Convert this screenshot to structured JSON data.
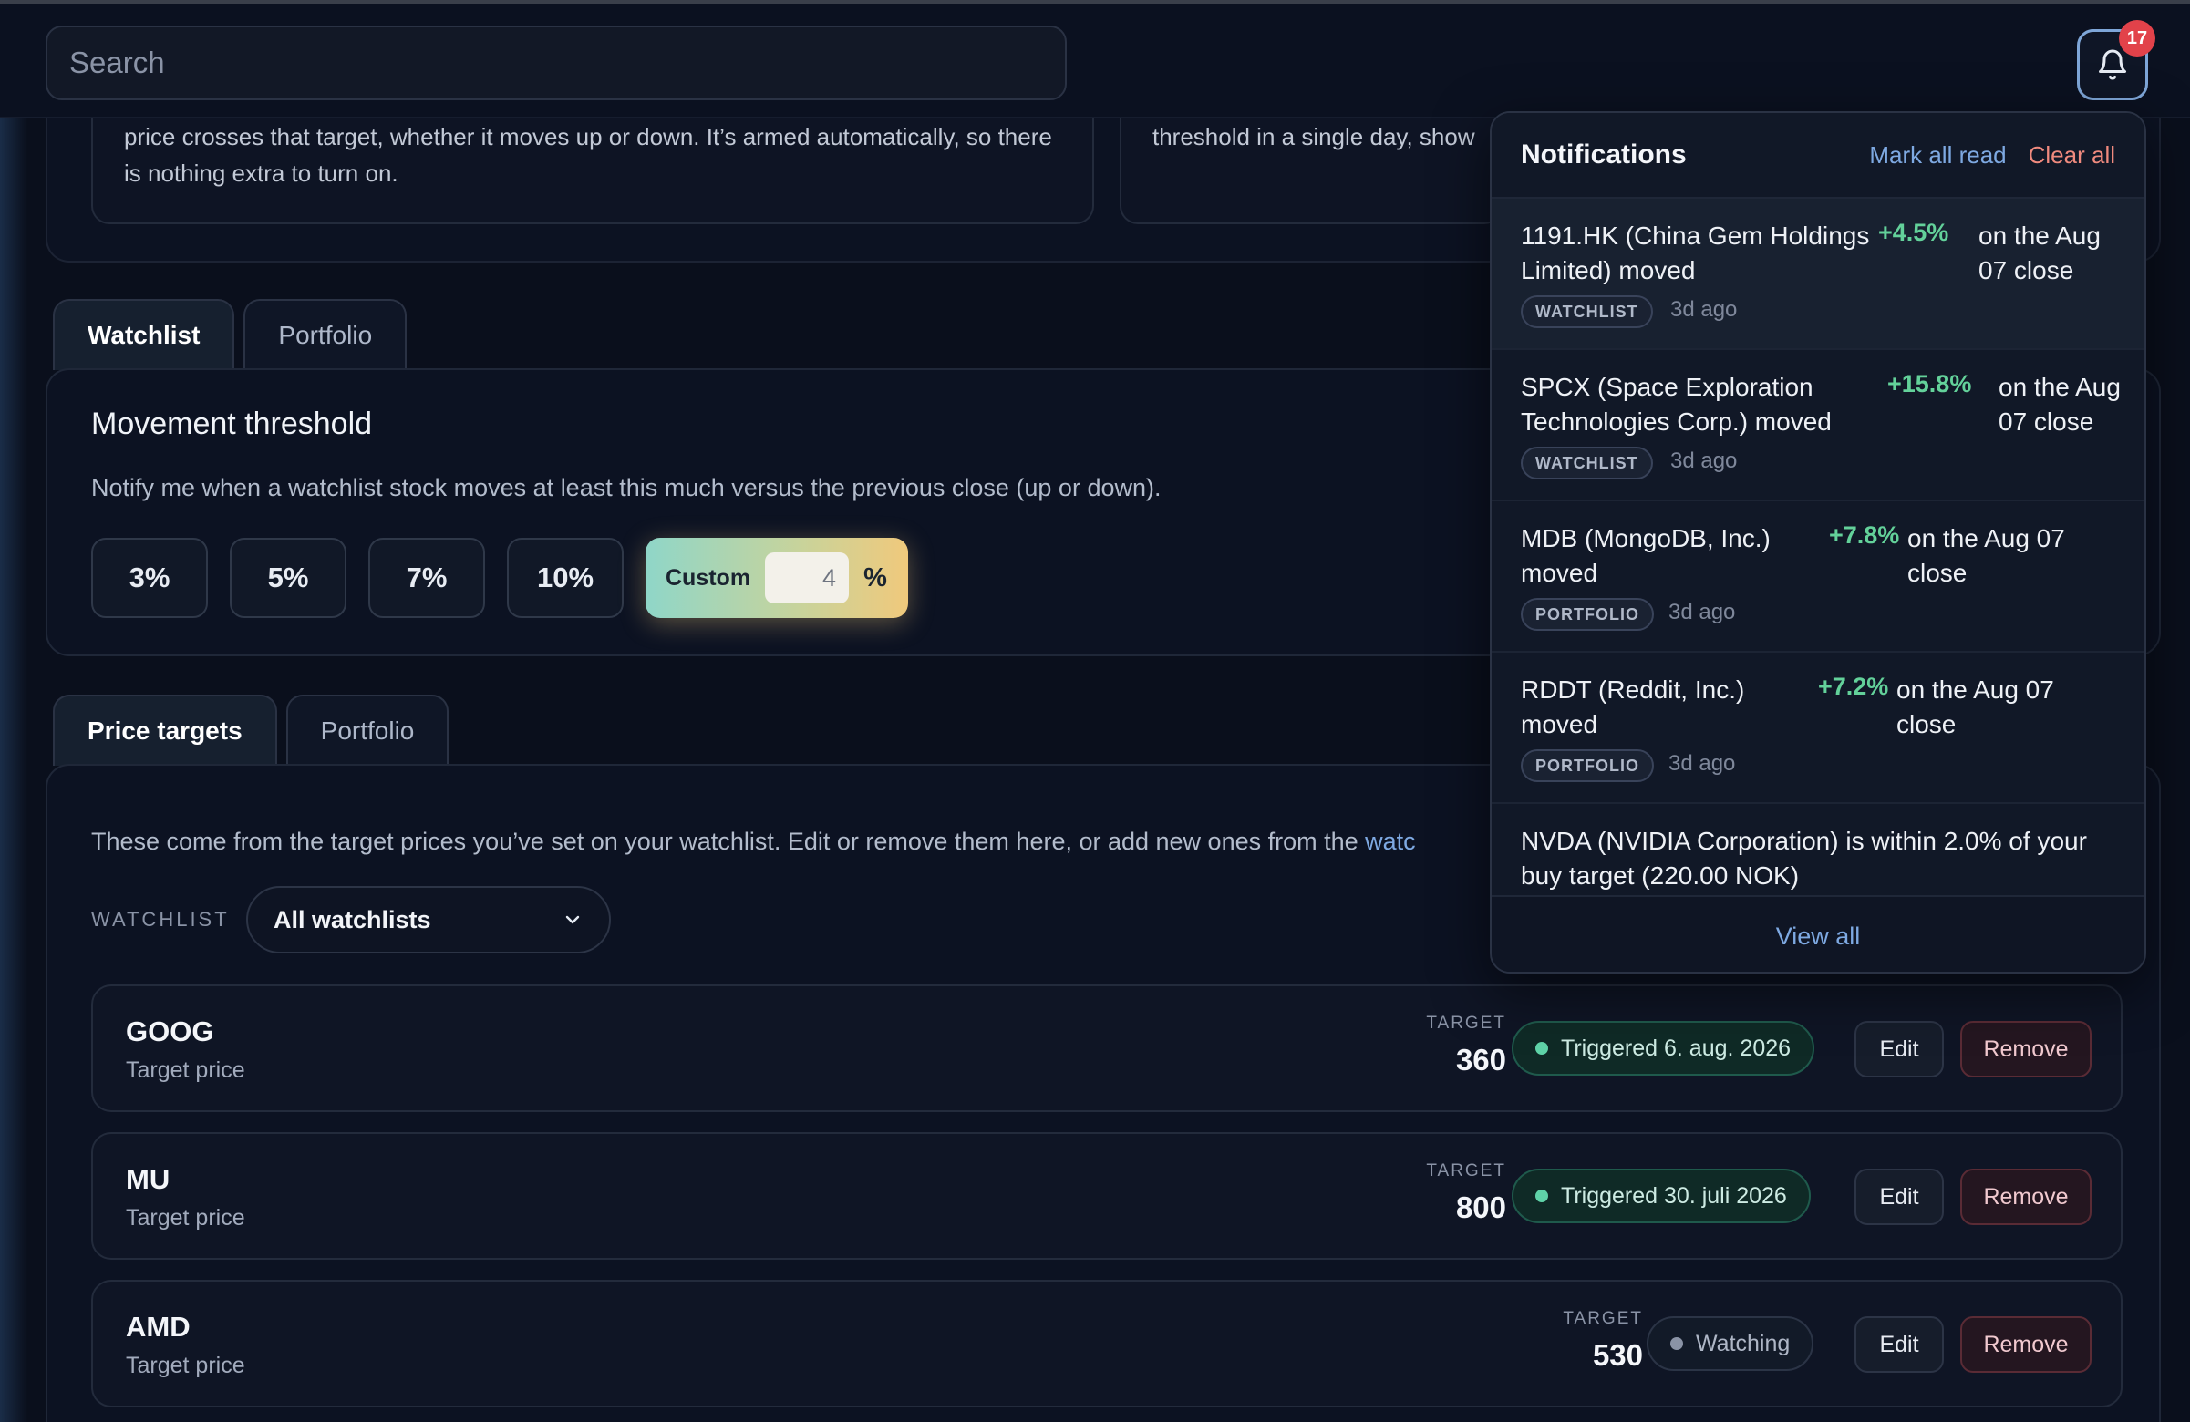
{
  "search": {
    "placeholder": "Search"
  },
  "notifications_badge": "17",
  "intro": {
    "card1_text": "price crosses that target, whether it moves up or down. It’s armed automatically, so there is nothing extra to turn on.",
    "card2_text": "threshold in a single day, show"
  },
  "threshold_tabs": [
    {
      "label": "Watchlist"
    },
    {
      "label": "Portfolio"
    }
  ],
  "movement": {
    "title": "Movement threshold",
    "description": "Notify me when a watchlist stock moves at least this much versus the previous close (up or down).",
    "presets": [
      "3%",
      "5%",
      "7%",
      "10%"
    ],
    "custom_label": "Custom",
    "custom_value": "4",
    "custom_unit": "%"
  },
  "target_tabs": [
    {
      "label": "Price targets"
    },
    {
      "label": "Portfolio"
    }
  ],
  "targets": {
    "description": "These come from the target prices you’ve set on your watchlist. Edit or remove them here, or add new ones from the ",
    "description_link": "watc",
    "filter_label": "WATCHLIST",
    "filter_value": "All watchlists",
    "target_label": "TARGET",
    "edit_label": "Edit",
    "remove_label": "Remove",
    "rows": [
      {
        "symbol": "GOOG",
        "subtitle": "Target price",
        "target": "360",
        "status": "Triggered 6. aug. 2026"
      },
      {
        "symbol": "MU",
        "subtitle": "Target price",
        "target": "800",
        "status": "Triggered 30. juli 2026"
      },
      {
        "symbol": "AMD",
        "subtitle": "Target price",
        "target": "530",
        "status": "Watching"
      }
    ]
  },
  "notifications": {
    "title": "Notifications",
    "mark_all_read": "Mark all read",
    "clear_all": "Clear all",
    "view_all": "View all",
    "items": [
      {
        "line1": "1191.HK (China Gem Holdings",
        "line2": "Limited) moved",
        "pct": "+4.5%",
        "rest1": "on the Aug",
        "rest2": "07 close",
        "tag": "WATCHLIST",
        "ago": "3d ago"
      },
      {
        "line1": "SPCX (Space Exploration",
        "line2": "Technologies Corp.) moved",
        "pct": "+15.8%",
        "rest1": "on the Aug",
        "rest2": "07 close",
        "tag": "WATCHLIST",
        "ago": "3d ago"
      },
      {
        "line1": "MDB (MongoDB, Inc.)",
        "line2": "moved",
        "pct": "+7.8%",
        "rest1": "on the Aug 07",
        "rest2": "close",
        "tag": "PORTFOLIO",
        "ago": "3d ago"
      },
      {
        "line1": "RDDT (Reddit, Inc.)",
        "line2": "moved",
        "pct": "+7.2%",
        "rest1": "on the Aug 07",
        "rest2": "close",
        "tag": "PORTFOLIO",
        "ago": "3d ago"
      },
      {
        "line1": "NVDA (NVIDIA Corporation) is within 2.0% of your",
        "line2": "buy target (220.00 NOK)"
      }
    ]
  },
  "colors": {
    "accent": "#7ea9e2",
    "positive": "#63d19a",
    "danger": "#f08a7e",
    "triggered_dot": "#5fd3a8",
    "watching_dot": "#8a93a6"
  }
}
